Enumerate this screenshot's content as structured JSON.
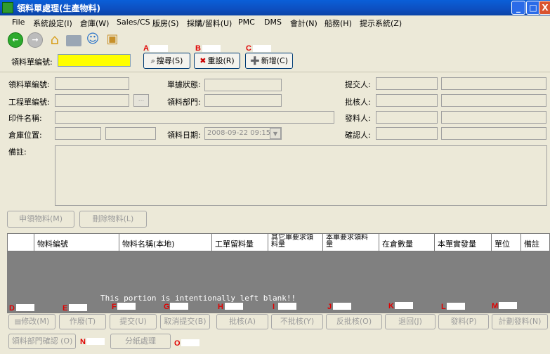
{
  "window": {
    "title": "領料單處理(生產物料)",
    "min_label": "_",
    "max_label": "□",
    "close_label": "X"
  },
  "menu": [
    "File",
    "系統設定(I)",
    "倉庫(W)",
    "Sales/CS",
    "版房(S)",
    "採購/留料(U)",
    "PMC",
    "DMS",
    "會計(N)",
    "船務(H)",
    "提示系統(Z)"
  ],
  "toolbar": {
    "back_icon": "back-arrow-icon",
    "forward_icon": "forward-arrow-icon",
    "home_icon": "home-icon",
    "print_icon": "printer-icon",
    "users_icon": "users-icon",
    "lock_icon": "lock-icon"
  },
  "search": {
    "label": "領料單編號:",
    "value": "",
    "search_button": "搜尋(S)",
    "reset_button": "重設(R)",
    "new_button": "新增(C)"
  },
  "markers": {
    "a": "A",
    "b": "B",
    "c": "C",
    "d": "D",
    "e": "E",
    "f": "F",
    "g": "G",
    "h": "H",
    "i": "I",
    "j": "J",
    "k": "K",
    "l": "L",
    "m": "M",
    "n": "N",
    "o": "O"
  },
  "form": {
    "order_no_label": "領料單編號:",
    "eng_no_label": "工程單編號:",
    "print_name_label": "印件名稱:",
    "warehouse_label": "倉庫位置:",
    "remarks_label": "備註:",
    "status_label": "單據狀態:",
    "dept_label": "領料部門:",
    "date_label": "領料日期:",
    "date_value": "2008-09-22 09:15",
    "submitter_label": "提交人:",
    "approver_label": "批核人:",
    "issuer_label": "發料人:",
    "confirmer_label": "確認人:",
    "browse_label": "..."
  },
  "item_buttons": {
    "apply": "申領物料(M)",
    "delete": "刪除物料(L)"
  },
  "grid": {
    "columns": [
      "物料編號",
      "物料名稱(本地)",
      "工單留料量",
      "其它單要求領料量",
      "本單要求領料量",
      "在倉數量",
      "本單實發量",
      "單位",
      "備註"
    ],
    "note": "This portion is intentionally left blank!!"
  },
  "actions": {
    "modify": "修改(M)",
    "void": "作廢(T)",
    "submit": "提交(U)",
    "cancel_submit": "取消提交(B)",
    "approve": "批核(A)",
    "reject": "不批核(Y)",
    "unapprove": "反批核(O)",
    "return": "退回(J)",
    "issue": "發料(P)",
    "plan_issue": "計劃發料(N)",
    "dept_confirm": "領料部門確認 (O)",
    "split": "分紙處理"
  }
}
